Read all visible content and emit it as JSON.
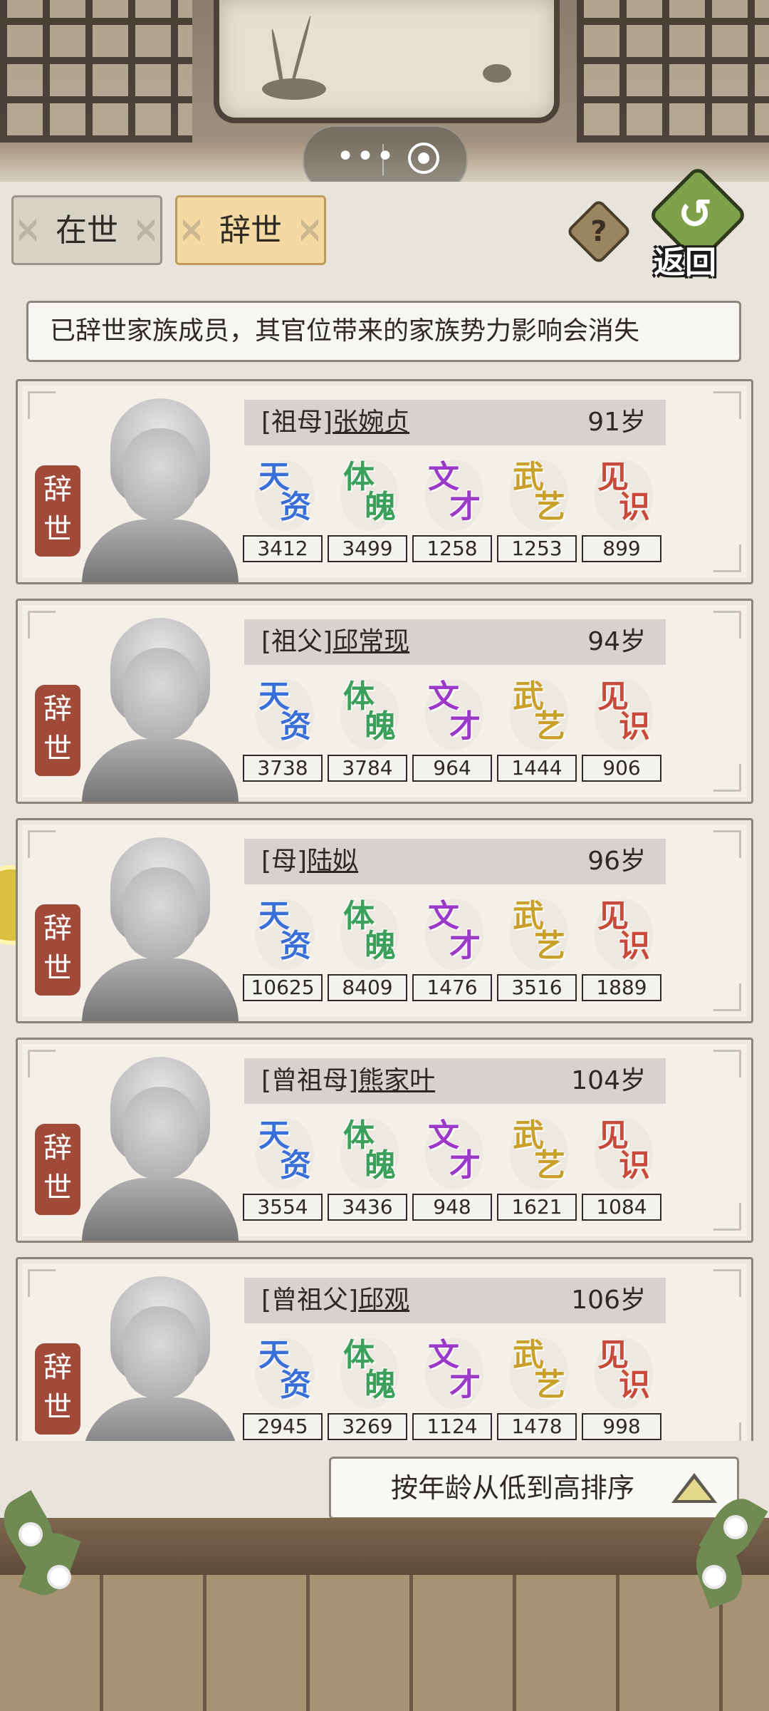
{
  "capsule": {
    "more_icon": "•••",
    "close_icon": "target-icon"
  },
  "tabs": {
    "alive": "在世",
    "deceased": "辞世"
  },
  "help_icon": "?",
  "back": {
    "arrow": "↺",
    "label": "返回"
  },
  "notice": "已辞世家族成员，其官位带来的家族势力影响会消失",
  "stat_labels": [
    {
      "ch1": "天",
      "ch2": "资",
      "color": "#3a6fd8"
    },
    {
      "ch1": "体",
      "ch2": "魄",
      "color": "#3aa05a"
    },
    {
      "ch1": "文",
      "ch2": "才",
      "color": "#9b3ac8"
    },
    {
      "ch1": "武",
      "ch2": "艺",
      "color": "#c9a12a"
    },
    {
      "ch1": "见",
      "ch2": "识",
      "color": "#c84a3a"
    }
  ],
  "status_seal": "辞世",
  "members": [
    {
      "relation": "[祖母]",
      "name": "张婉贞",
      "age": "91岁",
      "stats": [
        "3412",
        "3499",
        "1258",
        "1253",
        "899"
      ]
    },
    {
      "relation": "[祖父]",
      "name": "邱常现",
      "age": "94岁",
      "stats": [
        "3738",
        "3784",
        "964",
        "1444",
        "906"
      ]
    },
    {
      "relation": "[母]",
      "name": "陆姒",
      "age": "96岁",
      "stats": [
        "10625",
        "8409",
        "1476",
        "3516",
        "1889"
      ]
    },
    {
      "relation": "[曾祖母]",
      "name": "熊家叶",
      "age": "104岁",
      "stats": [
        "3554",
        "3436",
        "948",
        "1621",
        "1084"
      ]
    },
    {
      "relation": "[曾祖父]",
      "name": "邱观",
      "age": "106岁",
      "stats": [
        "2945",
        "3269",
        "1124",
        "1478",
        "998"
      ]
    }
  ],
  "sort_button": "按年龄从低到高排序"
}
